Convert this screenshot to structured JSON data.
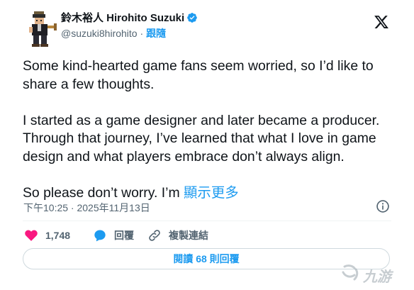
{
  "author": {
    "display_name": "鈴木裕人 Hirohito Suzuki",
    "handle": "@suzuki8hirohito",
    "separator": "·",
    "follow_label": "跟隨"
  },
  "tweet": {
    "paragraph1": "Some kind-hearted game fans seem worried, so I’d like to share a few thoughts.",
    "paragraph2": "I started as a game designer and later became a producer. Through that journey, I’ve learned that what I love in game design and what players embrace don’t always align.",
    "paragraph3": "So please don’t worry. I’m",
    "show_more_label": "顯示更多",
    "timestamp": "下午10:25 · 2025年11月13日"
  },
  "actions": {
    "like_count": "1,748",
    "reply_label": "回覆",
    "copy_link_label": "複製連結"
  },
  "read_replies_label": "閱讀 68 則回覆",
  "watermark": {
    "text": "九游"
  },
  "colors": {
    "accent": "#1d9bf0",
    "like": "#f91880",
    "text": "#0f1419",
    "muted": "#536471"
  },
  "icons": [
    "avatar",
    "verified-badge-icon",
    "x-logo-icon",
    "info-icon",
    "heart-icon",
    "reply-icon",
    "link-icon"
  ]
}
